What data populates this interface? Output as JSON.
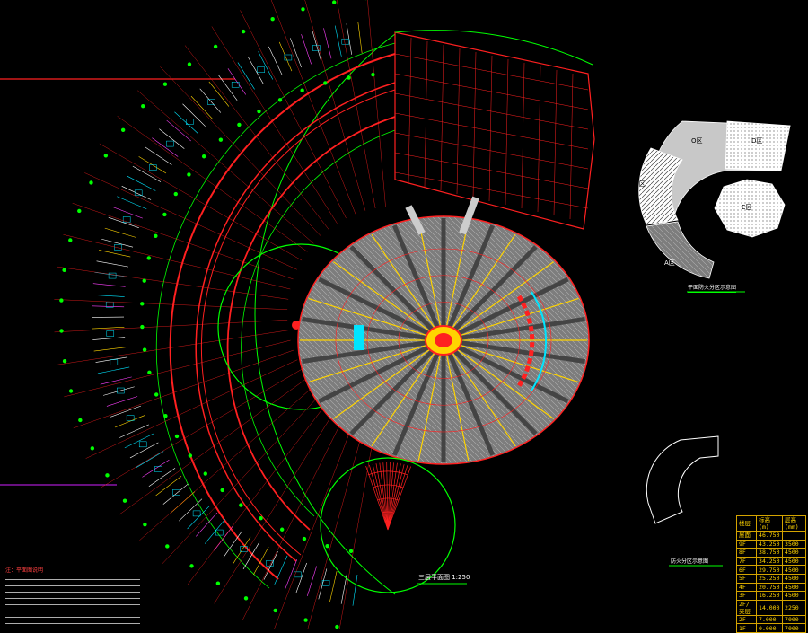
{
  "labels": {
    "third_floor_plan": "三层平面图  1:250",
    "fire_zone_diagram": "平面防火分区示意图",
    "evacuation_diagram": "防火分区示意图",
    "notes_title": "注：平面图说明"
  },
  "fire_zones": [
    "O区",
    "D区",
    "B区",
    "E区",
    "A区"
  ],
  "level_table": {
    "headers": [
      "楼层",
      "标高(m)",
      "层高(mm)"
    ],
    "rows": [
      [
        "屋面",
        "46.750",
        ""
      ],
      [
        "9F",
        "43.250",
        "3500"
      ],
      [
        "8F",
        "38.750",
        "4500"
      ],
      [
        "7F",
        "34.250",
        "4500"
      ],
      [
        "6F",
        "29.750",
        "4500"
      ],
      [
        "5F",
        "25.250",
        "4500"
      ],
      [
        "4F",
        "20.750",
        "4500"
      ],
      [
        "3F",
        "16.250",
        "4500"
      ],
      [
        "2F/夹层",
        "14.000",
        "2250"
      ],
      [
        "2F",
        "7.000",
        "7000"
      ],
      [
        "1F",
        "0.000",
        "7000"
      ]
    ]
  },
  "colors": {
    "background": "#000000",
    "axis": "#00ff00",
    "walls": "#ff2020",
    "hatch": "#8c8c8c",
    "accent": "#00e5ff",
    "table": "#ffd400"
  }
}
